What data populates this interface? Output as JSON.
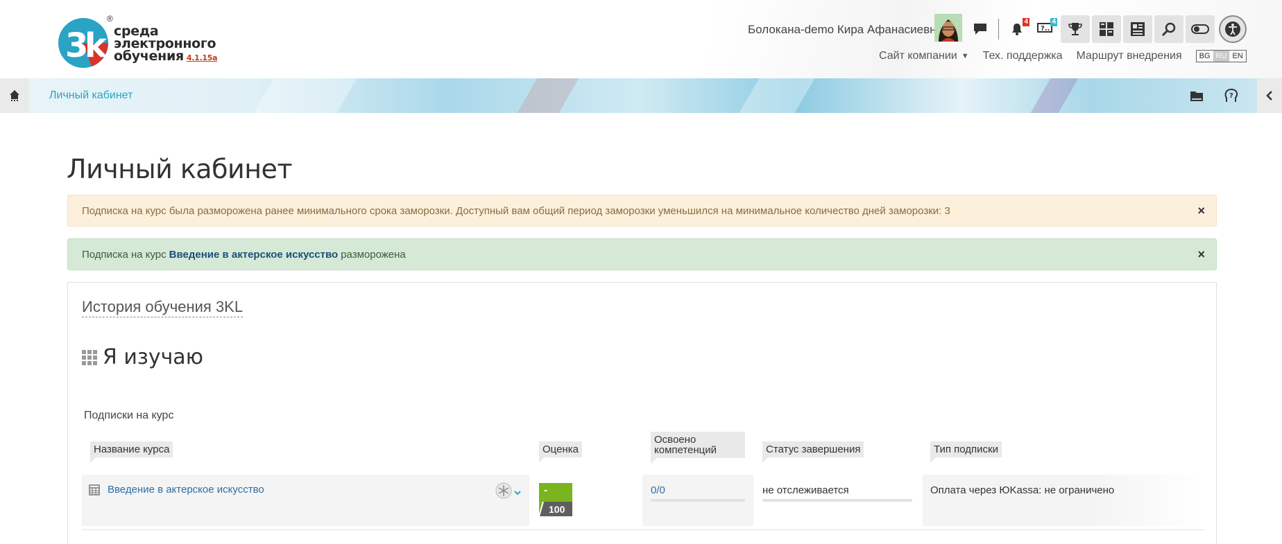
{
  "header": {
    "logo": {
      "reg": "®",
      "line1": "среда",
      "line2": "электронного",
      "line3": "обучения",
      "version": "4.1.15a"
    },
    "user_name": "Болокана-demo Кира Афанасиевна",
    "badges": {
      "notifications": "4",
      "questions": "4"
    },
    "nav": {
      "company_site": "Сайт компании",
      "support": "Тех. поддержка",
      "roadmap": "Маршрут внедрения"
    },
    "languages": [
      "BG",
      "RU",
      "EN"
    ],
    "active_language": "RU"
  },
  "breadcrumb": {
    "current": "Личный кабинет"
  },
  "page": {
    "title": "Личный кабинет",
    "alert_warning": "Подписка на курс была разморожена ранее минимального срока заморозки. Доступный вам общий период заморозки уменьшился на минимальное количество дней заморозки: 3",
    "alert_success": {
      "prefix": "Подписка на курс",
      "course": "Введение в актерское искусство",
      "suffix": "разморожена"
    },
    "close_symbol": "×"
  },
  "card": {
    "title": "История обучения 3KL",
    "section": "Я изучаю",
    "subtitle": "Подписки на курс",
    "columns": {
      "course": "Название курса",
      "grade": "Оценка",
      "competencies": "Освоено компетенций",
      "status": "Статус завершения",
      "subscription": "Тип подписки"
    },
    "rows": [
      {
        "course": "Введение в актерское искусство",
        "grade": "-",
        "grade_max": "100",
        "competencies": "0/0",
        "status": "не отслеживается",
        "subscription": "Оплата через ЮKassa: не ограничено"
      }
    ]
  },
  "colors": {
    "accent": "#2aa3c5",
    "link": "#2d6ea6",
    "grade_green": "#7ab51d",
    "warning_bg": "#fcefdc",
    "success_bg": "#d6e9d6"
  }
}
